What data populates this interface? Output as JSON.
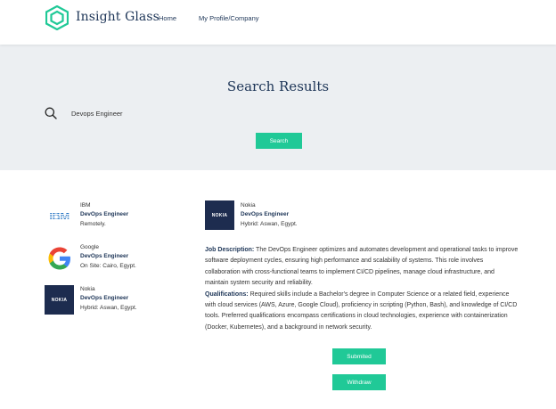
{
  "header": {
    "brand": "Insight Glass",
    "nav": [
      {
        "label": "Home"
      },
      {
        "label": "My Profile/Company"
      }
    ]
  },
  "search": {
    "title": "Search Results",
    "query": "Devops Engineer",
    "button_label": "Search",
    "icon": "search-icon"
  },
  "results": [
    {
      "company": "IBM",
      "title": "DevOps Engineer",
      "location": "Remotely.",
      "logo": "ibm-logo",
      "logo_text": "IBM"
    },
    {
      "company": "Google",
      "title": "DevOps Engineer",
      "location": "On Site: Cairo, Egypt.",
      "logo": "google-logo"
    },
    {
      "company": "Nokia",
      "title": "DevOps Engineer",
      "location": "Hybrid: Aswan, Egypt.",
      "logo": "nokia-logo",
      "logo_text": "NOKIA"
    }
  ],
  "detail": {
    "company": "Nokia",
    "title": "DevOps Engineer",
    "location": "Hybrid: Aswan, Egypt.",
    "logo_text": "NOKIA",
    "description_label": "Job Description:",
    "description": " The DevOps Engineer optimizes and automates development and operational tasks to improve software deployment cycles, ensuring high performance and scalability of systems. This role involves collaboration with cross-functional teams to implement CI/CD pipelines, manage cloud infrastructure, and maintain system security and reliability.",
    "qualifications_label": "Qualifications:",
    "qualifications": " Required skills include a Bachelor's degree in Computer Science or a related field, experience with cloud services (AWS, Azure, Google Cloud), proficiency in scripting (Python, Bash), and knowledge of CI/CD tools. Preferred qualifications encompass certifications in cloud technologies, experience with containerization (Docker, Kubernetes), and a background in network security.",
    "submitted_label": "Submited",
    "withdraw_label": "Withdraw"
  },
  "colors": {
    "accent": "#20c997",
    "brand_navy": "#1d3557",
    "hero_bg": "#eceff2",
    "nokia_bg": "#1d2c4f"
  }
}
